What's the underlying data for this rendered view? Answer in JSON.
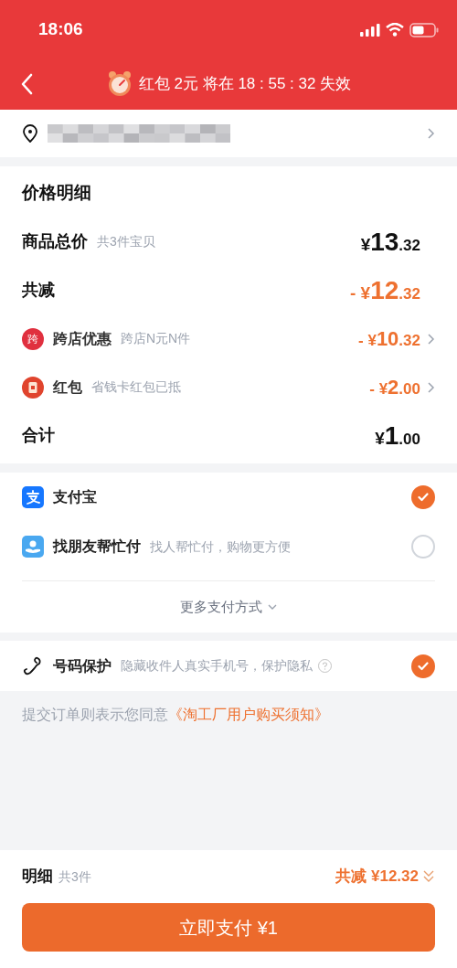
{
  "status_bar": {
    "time": "18:06"
  },
  "nav": {
    "countdown_prefix": "红包",
    "countdown_amount": "2元",
    "countdown_middle": "将在",
    "countdown_time": "18 : 55 : 32",
    "countdown_suffix": "失效"
  },
  "price_details": {
    "title": "价格明细",
    "rows": [
      {
        "kind": "plain",
        "label": "商品总价",
        "note": "共3件宝贝",
        "prefix": "",
        "currency": "¥",
        "integer": "13",
        "decimal": ".32"
      },
      {
        "kind": "reduction",
        "label": "共减",
        "prefix": "- ",
        "currency": "¥",
        "integer": "12",
        "decimal": ".32"
      },
      {
        "kind": "subitem",
        "badge": "跨",
        "label": "跨店优惠",
        "note": "跨店N元N件",
        "prefix": "- ",
        "currency": "¥",
        "integer": "10",
        "decimal": ".32"
      },
      {
        "kind": "subitem",
        "label": "红包",
        "note": "省钱卡红包已抵",
        "prefix": "- ",
        "currency": "¥",
        "integer": "2",
        "decimal": ".00"
      },
      {
        "kind": "plain",
        "label": "合计",
        "prefix": "",
        "currency": "¥",
        "integer": "1",
        "decimal": ".00"
      }
    ]
  },
  "payment_methods": {
    "items": [
      {
        "label": "支付宝",
        "selected": true
      },
      {
        "label": "找朋友帮忙付",
        "note": "找人帮忙付，购物更方便",
        "selected": false
      }
    ],
    "more": "更多支付方式"
  },
  "number_protection": {
    "label": "号码保护",
    "note": "隐藏收件人真实手机号，保护隐私",
    "checked": true
  },
  "agreement": {
    "text": "提交订单则表示您同意",
    "link": "《淘工厂用户购买须知》"
  },
  "footer": {
    "label": "明细",
    "count": "共3件",
    "savings": "共减 ¥12.32",
    "pay_button": "立即支付 ¥1"
  }
}
